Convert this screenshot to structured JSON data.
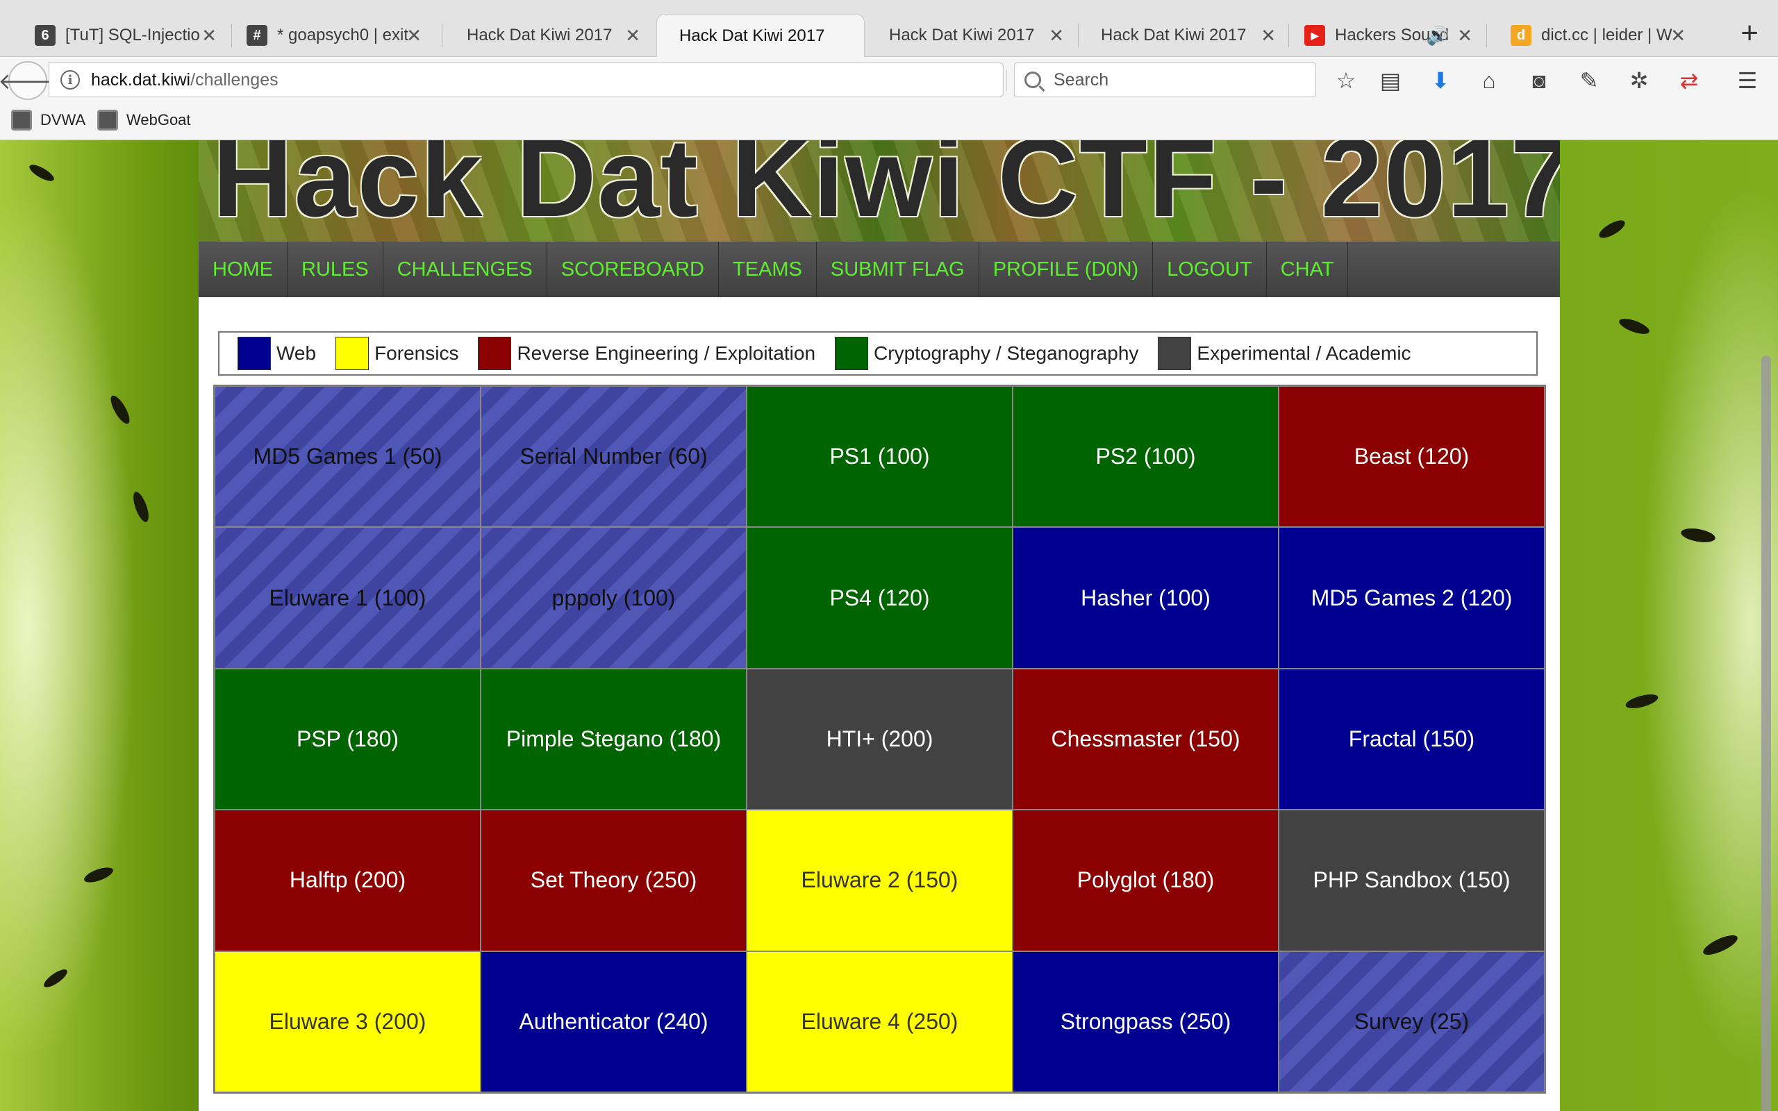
{
  "browser": {
    "tabs": [
      {
        "title": "[TuT] SQL-Injectio",
        "icon": "tut-favicon",
        "color": "#444444",
        "glyph": "6"
      },
      {
        "title": "* goapsych0 | exit",
        "icon": "hash-favicon",
        "color": "#444444",
        "glyph": "#"
      },
      {
        "title": "Hack Dat Kiwi 2017",
        "icon": "",
        "color": "",
        "glyph": ""
      },
      {
        "title": "Hack Dat Kiwi 2017",
        "icon": "",
        "color": "",
        "glyph": "",
        "active": true
      },
      {
        "title": "Hack Dat Kiwi 2017",
        "icon": "",
        "color": "",
        "glyph": ""
      },
      {
        "title": "Hack Dat Kiwi 2017",
        "icon": "",
        "color": "",
        "glyph": ""
      },
      {
        "title": "Hackers Sound",
        "icon": "youtube-favicon",
        "color": "#e62117",
        "glyph": "▶"
      },
      {
        "title": "dict.cc | leider | W",
        "icon": "dictcc-favicon",
        "color": "#f5a623",
        "glyph": "d"
      }
    ],
    "url": {
      "host": "hack.dat.kiwi",
      "path": "/challenges"
    },
    "search_placeholder": "Search",
    "bookmarks": [
      "DVWA",
      "WebGoat"
    ]
  },
  "site": {
    "title": "Hack Dat Kiwi CTF - 2017",
    "nav": [
      "HOME",
      "RULES",
      "CHALLENGES",
      "SCOREBOARD",
      "TEAMS",
      "SUBMIT FLAG",
      "PROFILE (D0N)",
      "LOGOUT",
      "CHAT"
    ]
  },
  "legend": [
    {
      "label": "Web",
      "color": "#000090"
    },
    {
      "label": "Forensics",
      "color": "#ffff00"
    },
    {
      "label": "Reverse Engineering / Exploitation",
      "color": "#8b0000"
    },
    {
      "label": "Cryptography / Steganography",
      "color": "#006400"
    },
    {
      "label": "Experimental / Academic",
      "color": "#424242"
    }
  ],
  "challenges": [
    {
      "label": "MD5 Games 1 (50)",
      "category": "web",
      "solved": true
    },
    {
      "label": "Serial Number (60)",
      "category": "web",
      "solved": true
    },
    {
      "label": "PS1 (100)",
      "category": "crypto",
      "solved": false
    },
    {
      "label": "PS2 (100)",
      "category": "crypto",
      "solved": false
    },
    {
      "label": "Beast (120)",
      "category": "reverse",
      "solved": false
    },
    {
      "label": "Eluware 1 (100)",
      "category": "web",
      "solved": true
    },
    {
      "label": "pppoly (100)",
      "category": "web",
      "solved": true
    },
    {
      "label": "PS4 (120)",
      "category": "crypto",
      "solved": false
    },
    {
      "label": "Hasher (100)",
      "category": "web",
      "solved": false
    },
    {
      "label": "MD5 Games 2 (120)",
      "category": "web",
      "solved": false
    },
    {
      "label": "PSP (180)",
      "category": "crypto",
      "solved": false
    },
    {
      "label": "Pimple Stegano (180)",
      "category": "crypto",
      "solved": false
    },
    {
      "label": "HTI+ (200)",
      "category": "experimental",
      "solved": false
    },
    {
      "label": "Chessmaster (150)",
      "category": "reverse",
      "solved": false
    },
    {
      "label": "Fractal (150)",
      "category": "web",
      "solved": false
    },
    {
      "label": "Halftp (200)",
      "category": "reverse",
      "solved": false
    },
    {
      "label": "Set Theory (250)",
      "category": "reverse",
      "solved": false
    },
    {
      "label": "Eluware 2 (150)",
      "category": "forensics",
      "solved": false
    },
    {
      "label": "Polyglot (180)",
      "category": "reverse",
      "solved": false
    },
    {
      "label": "PHP Sandbox (150)",
      "category": "experimental",
      "solved": false
    },
    {
      "label": "Eluware 3 (200)",
      "category": "forensics",
      "solved": false
    },
    {
      "label": "Authenticator (240)",
      "category": "web",
      "solved": false
    },
    {
      "label": "Eluware 4 (250)",
      "category": "forensics",
      "solved": false
    },
    {
      "label": "Strongpass (250)",
      "category": "web",
      "solved": false
    },
    {
      "label": "Survey (25)",
      "category": "web",
      "solved": true
    }
  ]
}
